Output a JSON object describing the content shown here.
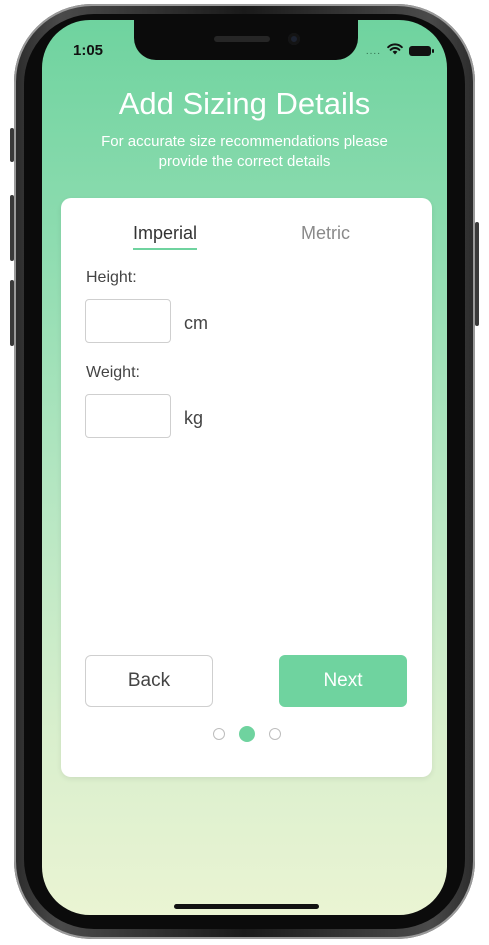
{
  "status_bar": {
    "time": "1:05",
    "signal": "....",
    "wifi_icon": "wifi-icon",
    "battery_icon": "battery-icon"
  },
  "header": {
    "title": "Add Sizing Details",
    "subtitle": "For accurate size recommendations please provide the correct details"
  },
  "tabs": {
    "imperial": "Imperial",
    "metric": "Metric",
    "active": "Imperial"
  },
  "form": {
    "height": {
      "label": "Height:",
      "value": "",
      "unit": "cm"
    },
    "weight": {
      "label": "Weight:",
      "value": "",
      "unit": "kg"
    }
  },
  "actions": {
    "back_label": "Back",
    "next_label": "Next"
  },
  "pagination": {
    "total": 3,
    "current": 2
  },
  "colors": {
    "accent": "#6fd39f",
    "background_top": "#6fd39f",
    "background_bottom": "#eaf4d3"
  }
}
